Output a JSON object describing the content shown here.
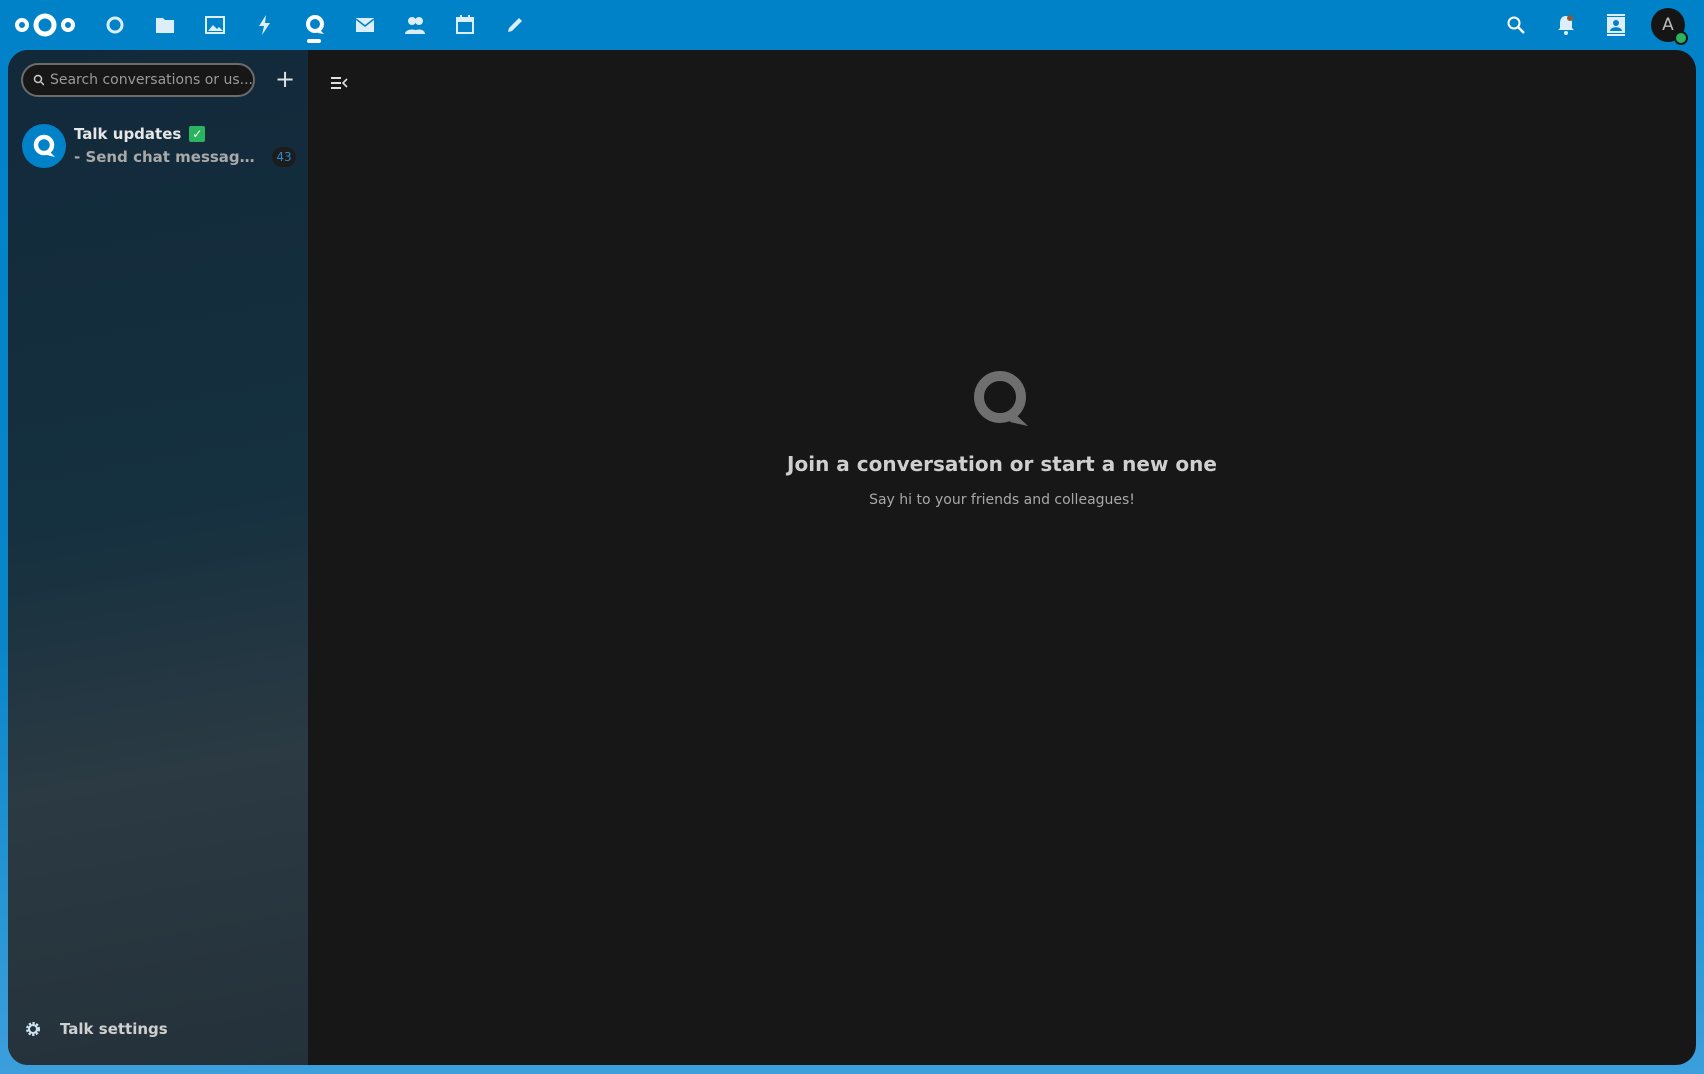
{
  "topbar": {
    "apps": [
      {
        "name": "dashboard",
        "icon": "dashboard-icon"
      },
      {
        "name": "files",
        "icon": "folder-icon"
      },
      {
        "name": "photos",
        "icon": "image-icon"
      },
      {
        "name": "activity",
        "icon": "lightning-icon"
      },
      {
        "name": "talk",
        "icon": "talk-icon",
        "active": true
      },
      {
        "name": "mail",
        "icon": "mail-icon"
      },
      {
        "name": "contacts",
        "icon": "contacts-icon"
      },
      {
        "name": "calendar",
        "icon": "calendar-icon"
      },
      {
        "name": "notes",
        "icon": "pencil-icon"
      }
    ],
    "avatar_letter": "A",
    "accent": "#0082c9"
  },
  "sidebar": {
    "search_placeholder": "Search conversations or us...",
    "conversations": [
      {
        "title": "Talk updates",
        "last_message": "- Send chat messages wit...",
        "unread": "43"
      }
    ],
    "settings_label": "Talk settings"
  },
  "main": {
    "empty_title": "Join a conversation or start a new one",
    "empty_subtitle": "Say hi to your friends and colleagues!"
  }
}
